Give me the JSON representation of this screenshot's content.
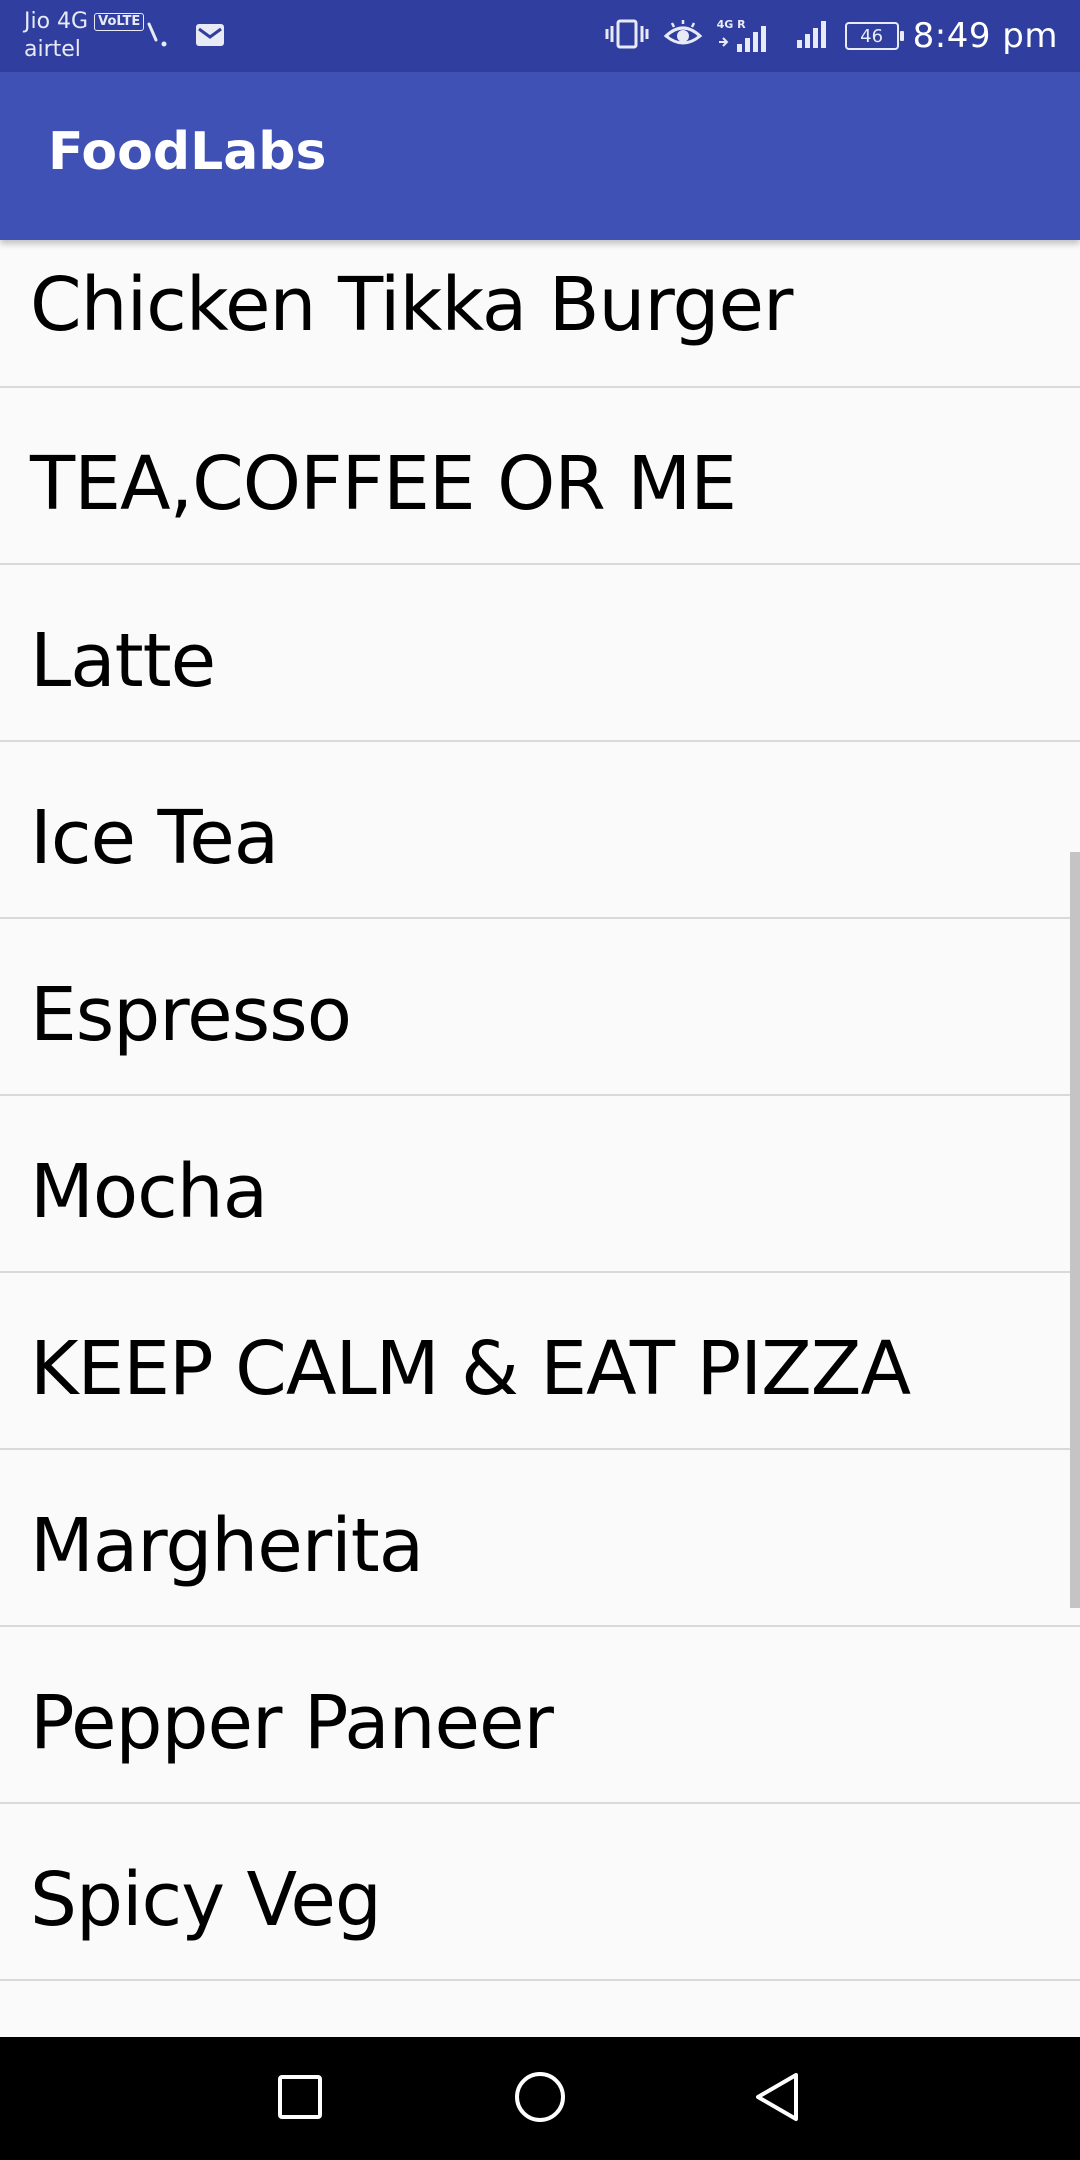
{
  "status_bar": {
    "carrier_primary": "Jio 4G",
    "volte_badge": "VoLTE",
    "carrier_secondary": "airtel",
    "network_badge": "4G R",
    "battery_level": "46",
    "time": "8:49 pm",
    "icons": [
      "missed-call-icon",
      "email-icon",
      "vibrate-icon",
      "eye-comfort-icon",
      "signal-icon",
      "signal-icon-2",
      "battery-icon"
    ]
  },
  "app_bar": {
    "title": "FoodLabs"
  },
  "menu": {
    "items": [
      {
        "label": "Chicken Tikka Burger"
      },
      {
        "label": "TEA,COFFEE OR ME"
      },
      {
        "label": "Latte"
      },
      {
        "label": "Ice Tea"
      },
      {
        "label": "Espresso"
      },
      {
        "label": "Mocha"
      },
      {
        "label": "KEEP CALM & EAT PIZZA"
      },
      {
        "label": "Margherita"
      },
      {
        "label": "Pepper Paneer"
      },
      {
        "label": "Spicy Veg"
      }
    ]
  },
  "nav_bar": {
    "buttons": [
      "recents-button",
      "home-button",
      "back-button"
    ]
  },
  "colors": {
    "status_bar": "#303f9f",
    "app_bar": "#3f51b5",
    "background": "#fafafa",
    "divider": "#d9d9d9",
    "nav_bar": "#000000"
  }
}
